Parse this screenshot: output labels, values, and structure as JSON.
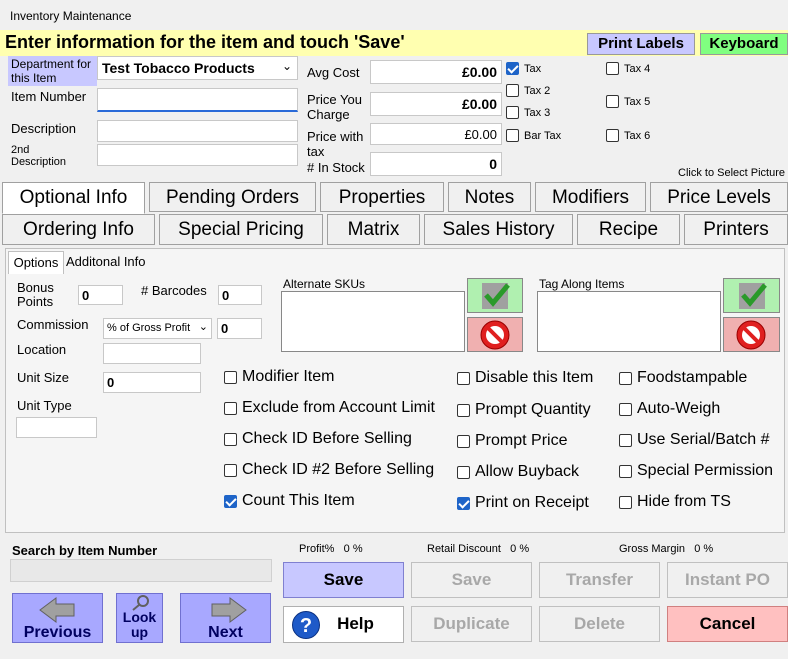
{
  "window": {
    "title": "Inventory Maintenance"
  },
  "banner": {
    "text": "Enter information for the item and touch 'Save'",
    "print_labels": "Print Labels",
    "keyboard": "Keyboard"
  },
  "item": {
    "department_label": "Department for this Item",
    "department_value": "Test Tobacco Products",
    "item_number_label": "Item Number",
    "description_label": "Description",
    "description2_label": "2nd Description",
    "avg_cost_label": "Avg Cost",
    "avg_cost_value": "£0.00",
    "price_label": "Price You Charge",
    "price_value": "£0.00",
    "price_tax_label": "Price with tax",
    "price_tax_value": "£0.00",
    "in_stock_label": "# In Stock",
    "in_stock_value": "0",
    "click_picture": "Click to Select Picture"
  },
  "taxes": {
    "tax": "Tax",
    "tax2": "Tax 2",
    "tax3": "Tax 3",
    "bar_tax": "Bar Tax",
    "tax4": "Tax 4",
    "tax5": "Tax 5",
    "tax6": "Tax 6"
  },
  "tabs_row1": [
    "Optional Info",
    "Pending Orders",
    "Properties",
    "Notes",
    "Modifiers",
    "Price Levels"
  ],
  "tabs_row2": [
    "Ordering Info",
    "Special Pricing",
    "Matrix",
    "Sales History",
    "Recipe",
    "Printers"
  ],
  "subtabs": [
    "Options",
    "Additonal Info"
  ],
  "options": {
    "bonus_points_label": "Bonus Points",
    "bonus_points_value": "0",
    "barcodes_label": "# Barcodes",
    "barcodes_value": "0",
    "commission_label": "Commission",
    "commission_type": "% of Gross Profit",
    "commission_value": "0",
    "location_label": "Location",
    "unit_size_label": "Unit Size",
    "unit_size_value": "0",
    "unit_type_label": "Unit Type",
    "alt_skus_label": "Alternate SKUs",
    "tag_along_label": "Tag Along Items"
  },
  "checkboxes": {
    "col1": [
      "Modifier Item",
      "Exclude from Account Limit",
      "Check ID Before Selling",
      "Check ID #2 Before Selling",
      "Count This Item"
    ],
    "col2": [
      "Disable this Item",
      "Prompt Quantity",
      "Prompt Price",
      "Allow Buyback",
      "Print on Receipt"
    ],
    "col3": [
      "Foodstampable",
      "Auto-Weigh",
      "Use Serial/Batch #",
      "Special Permission",
      "Hide from TS"
    ]
  },
  "footer": {
    "search_label": "Search by Item Number",
    "profit_label": "Profit%",
    "profit_value": "0 %",
    "retail_discount_label": "Retail Discount",
    "retail_discount_value": "0 %",
    "gross_margin_label": "Gross Margin",
    "gross_margin_value": "0 %",
    "save": "Save",
    "save2": "Save",
    "transfer": "Transfer",
    "instant_po": "Instant PO",
    "help": "Help",
    "duplicate": "Duplicate",
    "delete": "Delete",
    "cancel": "Cancel",
    "previous": "Previous",
    "lookup": "Look up",
    "next": "Next"
  }
}
